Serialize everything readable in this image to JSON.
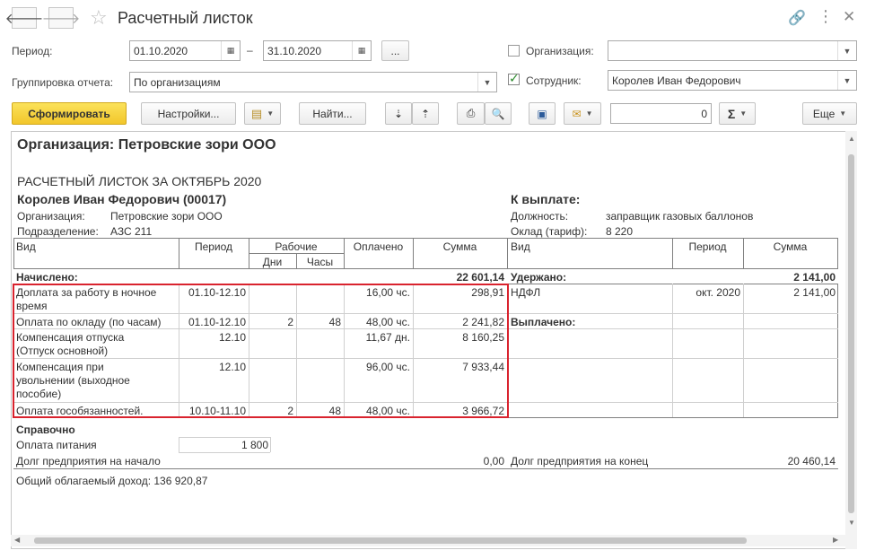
{
  "window": {
    "title": "Расчетный листок"
  },
  "form": {
    "period_label": "Период:",
    "period_from": "01.10.2020",
    "period_dash": "–",
    "period_to": "31.10.2020",
    "period_more": "...",
    "grouping_label": "Группировка отчета:",
    "grouping_value": "По организациям",
    "org_label": "Организация:",
    "org_value": "",
    "employee_label": "Сотрудник:",
    "employee_value": "Королев Иван Федорович"
  },
  "toolbar": {
    "generate": "Сформировать",
    "settings": "Настройки...",
    "find": "Найти...",
    "sum_value": "0",
    "more": "Еще"
  },
  "report": {
    "org_heading": "Организация: Петровские зори ООО",
    "sheet_title": "РАСЧЕТНЫЙ ЛИСТОК ЗА ОКТЯБРЬ 2020",
    "employee": "Королев Иван Федорович (00017)",
    "org_label": "Организация:",
    "org_value": "Петровские зори ООО",
    "dept_label": "Подразделение:",
    "dept_value": "АЗС 211",
    "to_pay_label": "К выплате:",
    "position_label": "Должность:",
    "position_value": "заправщик газовых баллонов",
    "salary_label": "Оклад (тариф):",
    "salary_value": "8 220",
    "headers": {
      "kind": "Вид",
      "period": "Период",
      "work": "Рабочие",
      "days": "Дни",
      "hours": "Часы",
      "paid": "Оплачено",
      "sum": "Сумма",
      "kind2": "Вид",
      "period2": "Период",
      "sum2": "Сумма"
    },
    "accrued_label": "Начислено:",
    "accrued_total": "22 601,14",
    "withheld_label": "Удержано:",
    "withheld_total": "2 141,00",
    "paid_out_label": "Выплачено:",
    "rows": [
      {
        "kind1": "Доплата за работу в ночное",
        "kind2": "время",
        "period": "01.10-12.10",
        "days": "",
        "hours": "",
        "paid": "16,00 чс.",
        "sum": "298,91"
      },
      {
        "kind1": "Оплата по окладу (по часам)",
        "kind2": "",
        "period": "01.10-12.10",
        "days": "2",
        "hours": "48",
        "paid": "48,00 чс.",
        "sum": "2 241,82"
      },
      {
        "kind1": "Компенсация отпуска",
        "kind2": "(Отпуск основной)",
        "period": "12.10",
        "days": "",
        "hours": "",
        "paid": "11,67 дн.",
        "sum": "8 160,25"
      },
      {
        "kind1": "Компенсация при",
        "kind2": "увольнении (выходное",
        "kind3": "пособие)",
        "period": "12.10",
        "days": "",
        "hours": "",
        "paid": "96,00 чс.",
        "sum": "7 933,44"
      },
      {
        "kind1": "Оплата гособязанностей.",
        "kind2": "",
        "period": "10.10-11.10",
        "days": "2",
        "hours": "48",
        "paid": "48,00 чс.",
        "sum": "3 966,72"
      }
    ],
    "withheld_row": {
      "kind": "НДФЛ",
      "period": "окт. 2020",
      "sum": "2 141,00"
    },
    "reference_label": "Справочно",
    "meal_label": "Оплата питания",
    "meal_value": "1 800",
    "debt_start_label": "Долг предприятия на начало",
    "debt_start_value": "0,00",
    "debt_end_label": "Долг предприятия на конец",
    "debt_end_value": "20 460,14",
    "taxable_income": "Общий облагаемый доход: 136 920,87"
  }
}
